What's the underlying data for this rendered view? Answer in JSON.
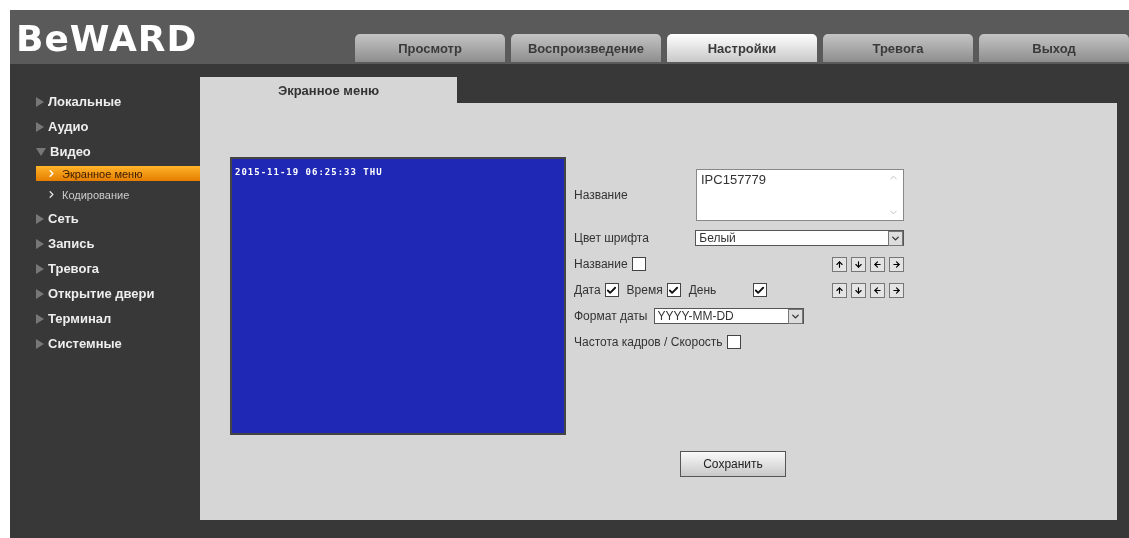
{
  "logo": "BeWARD",
  "nav_tabs": [
    {
      "label": "Просмотр",
      "selected": false
    },
    {
      "label": "Воспроизведение",
      "selected": false
    },
    {
      "label": "Настройки",
      "selected": true
    },
    {
      "label": "Тревога",
      "selected": false
    },
    {
      "label": "Выход",
      "selected": false
    }
  ],
  "sidebar": {
    "items": [
      {
        "label": "Локальные",
        "expanded": false
      },
      {
        "label": "Аудио",
        "expanded": false
      },
      {
        "label": "Видео",
        "expanded": true,
        "children": [
          {
            "label": "Экранное меню",
            "selected": true
          },
          {
            "label": "Кодирование",
            "selected": false
          }
        ]
      },
      {
        "label": "Сеть",
        "expanded": false
      },
      {
        "label": "Запись",
        "expanded": false
      },
      {
        "label": "Тревога",
        "expanded": false
      },
      {
        "label": "Открытие двери",
        "expanded": false
      },
      {
        "label": "Терминал",
        "expanded": false
      },
      {
        "label": "Системные",
        "expanded": false
      }
    ]
  },
  "page_tab": "Экранное меню",
  "preview": {
    "overlay": "2015-11-19 06:25:33 THU"
  },
  "form": {
    "rows": [
      {
        "kind": "textarea",
        "label": "Название",
        "value": "IPC157779"
      },
      {
        "kind": "select",
        "label": "Цвет шрифта",
        "value": "Белый"
      },
      {
        "kind": "checks",
        "items": [
          {
            "label": "Название",
            "checked": false
          }
        ],
        "arrows": true
      },
      {
        "kind": "checks",
        "items": [
          {
            "label": "Дата",
            "checked": true
          },
          {
            "label": "Время",
            "checked": true
          },
          {
            "label": "День",
            "checked": true
          }
        ],
        "arrows": true
      },
      {
        "kind": "inline-select",
        "label": "Формат даты",
        "value": "YYYY-MM-DD"
      },
      {
        "kind": "checks",
        "items": [
          {
            "label": "Частота кадров / Скорость",
            "checked": false
          }
        ],
        "arrows": false
      }
    ],
    "save": "Сохранить"
  }
}
